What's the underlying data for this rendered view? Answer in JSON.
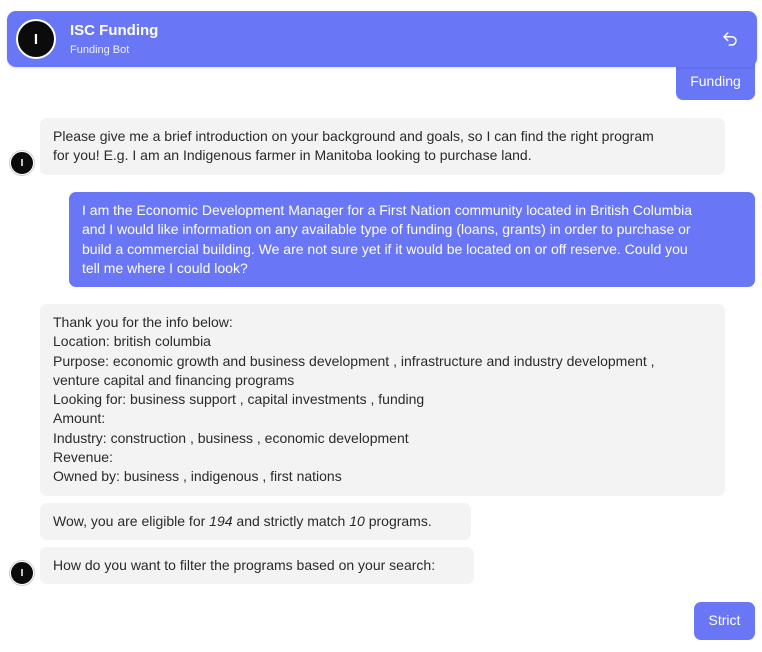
{
  "header": {
    "avatar_initial": "I",
    "title": "ISC Funding",
    "subtitle": "Funding Bot",
    "action_icon": "reply-arrow-icon"
  },
  "bot": {
    "avatar_initial": "I"
  },
  "messages": {
    "user_funding": "Funding",
    "bot_intro": [
      "Please give me a brief introduction on your background and goals, so I can find the right program",
      "for you! E.g. I am an Indigenous farmer in Manitoba looking to purchase land."
    ],
    "user_background": [
      "I am the Economic Development Manager for a First Nation community located in British Columbia",
      "and I would like information on any available type of funding (loans, grants) in order to purchase or",
      "build a commercial building. We are not sure yet if it would be located on or off reserve. Could you",
      "tell me where I could look?"
    ],
    "bot_summary": [
      "Thank you for the info below:",
      "Location: british columbia",
      "Purpose: economic growth and business development , infrastructure and industry development ,",
      "venture capital and financing programs",
      "Looking for: business support , capital investments , funding",
      "Amount:",
      "Industry: construction , business , economic development",
      "Revenue:",
      "Owned by: business , indigenous , first nations"
    ],
    "eligibility": {
      "prefix": "Wow, you are eligible for",
      "eligible_count": "194",
      "middle": "and strictly match",
      "match_count": "10",
      "suffix": "programs."
    },
    "bot_filter": "How do you want to filter the programs based on your search:",
    "user_strict": "Strict"
  },
  "colors": {
    "accent": "#6977f7",
    "bot_bubble": "#f3f3f3",
    "avatar": "#0b0b0b"
  }
}
